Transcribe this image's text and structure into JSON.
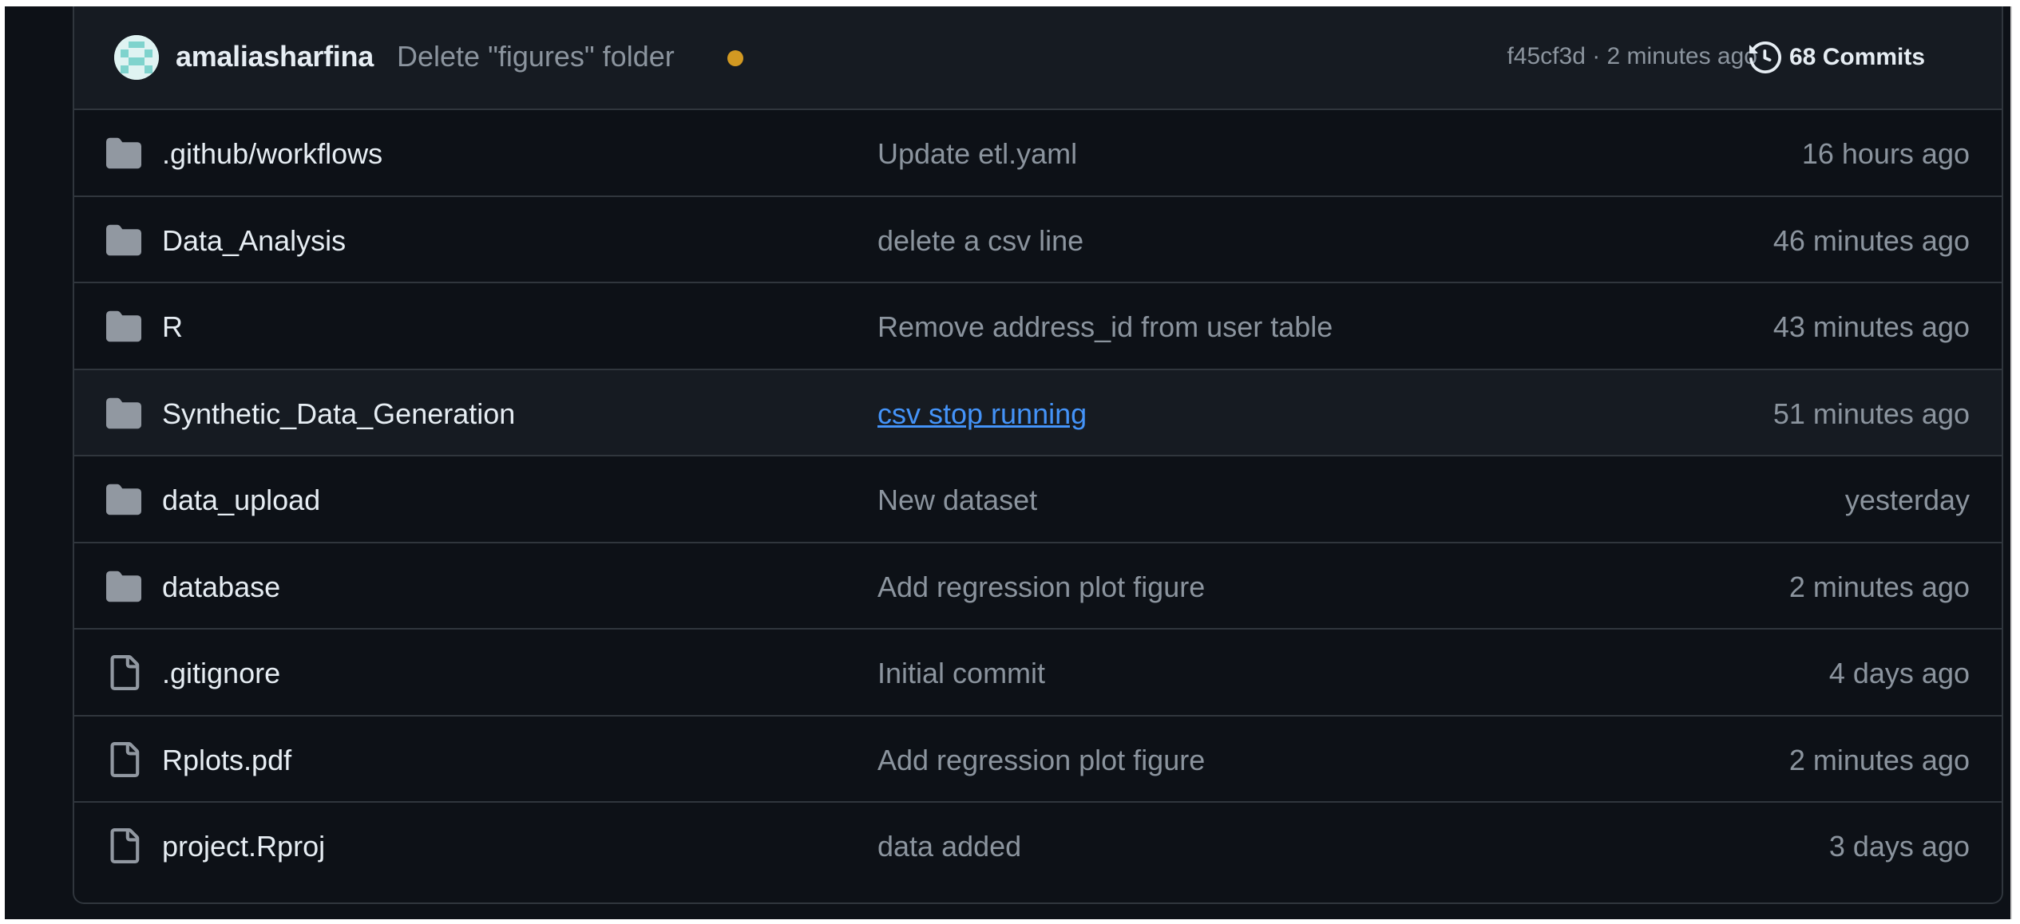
{
  "latest_commit": {
    "author": "amaliasharfina",
    "message": "Delete \"figures\" folder",
    "status_color": "#d29922",
    "meta": "f45cf3d · 2 minutes ago",
    "commits_label": "68 Commits"
  },
  "files": [
    {
      "type": "folder",
      "name": ".github/workflows",
      "message": "Update etl.yaml",
      "time": "16 hours ago"
    },
    {
      "type": "folder",
      "name": "Data_Analysis",
      "message": "delete a csv line",
      "time": "46 minutes ago"
    },
    {
      "type": "folder",
      "name": "R",
      "message": "Remove address_id from user table",
      "time": "43 minutes ago"
    },
    {
      "type": "folder",
      "name": "Synthetic_Data_Generation",
      "message": "csv stop running",
      "time": "51 minutes ago",
      "hovered": true
    },
    {
      "type": "folder",
      "name": "data_upload",
      "message": "New dataset",
      "time": "yesterday"
    },
    {
      "type": "folder",
      "name": "database",
      "message": "Add regression plot figure",
      "time": "2 minutes ago"
    },
    {
      "type": "file",
      "name": ".gitignore",
      "message": "Initial commit",
      "time": "4 days ago"
    },
    {
      "type": "file",
      "name": "Rplots.pdf",
      "message": "Add regression plot figure",
      "time": "2 minutes ago"
    },
    {
      "type": "file",
      "name": "project.Rproj",
      "message": "data added",
      "time": "3 days ago"
    }
  ],
  "colors": {
    "background": "#0d1117",
    "header_background": "#161b22",
    "border": "#30363d",
    "text_primary": "#e6edf3",
    "text_muted": "#8b949e",
    "link": "#4493f8",
    "icon": "#9198a1"
  },
  "icons": {
    "folder": "folder-icon",
    "file": "file-icon",
    "history": "history-icon",
    "avatar": "identicon-avatar"
  }
}
